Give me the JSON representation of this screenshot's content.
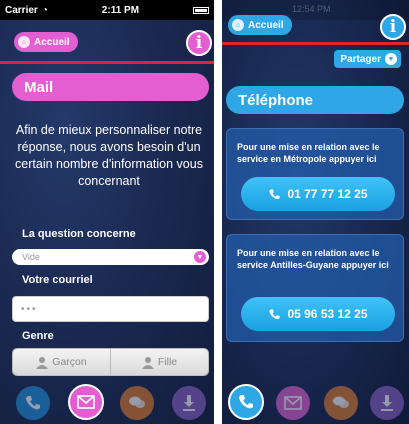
{
  "left_screen": {
    "status_bar": {
      "carrier": "Carrier",
      "time": "2:11 PM"
    },
    "header": {
      "home_label": "Accueil",
      "info_glyph": "i"
    },
    "title": "Mail",
    "intro_text": "Afin de mieux personnaliser notre réponse, nous avons besoin d'un certain nombre d'information vous concernant",
    "question_label": "La question concerne",
    "question_select": {
      "value": "Vide"
    },
    "email_label": "Votre courriel",
    "email_field": {
      "value": "•••"
    },
    "gender_label": "Genre",
    "gender_options": [
      "Garçon",
      "Fille"
    ],
    "tabs": [
      {
        "icon": "phone-icon",
        "color": "#1f8fd8"
      },
      {
        "icon": "mail-icon",
        "color": "#e35fd1"
      },
      {
        "icon": "chat-icon",
        "color": "#e07a2a"
      },
      {
        "icon": "download-icon",
        "color": "#8a5fc6"
      }
    ]
  },
  "right_screen": {
    "status_bar": {
      "time": "12:54 PM"
    },
    "header": {
      "home_label": "Accueil",
      "info_glyph": "i"
    },
    "share_label": "Partager",
    "title": "Téléphone",
    "cards": [
      {
        "text": "Pour une mise en relation avec le service en Métropole appuyer ici",
        "phone": "01 77 77 12 25"
      },
      {
        "text": "Pour une mise en relation avec le service Antilles-Guyane appuyer ici",
        "phone": "05 96 53 12 25"
      }
    ],
    "tabs": [
      {
        "icon": "phone-icon",
        "color": "#2fa6e6"
      },
      {
        "icon": "mail-icon",
        "color": "#e35fd1"
      },
      {
        "icon": "chat-icon",
        "color": "#e07a2a"
      },
      {
        "icon": "download-icon",
        "color": "#8a5fc6"
      }
    ]
  },
  "colors": {
    "pink": "#e35fd1",
    "blue": "#2fa6e6",
    "red_line": "#e0242b"
  }
}
